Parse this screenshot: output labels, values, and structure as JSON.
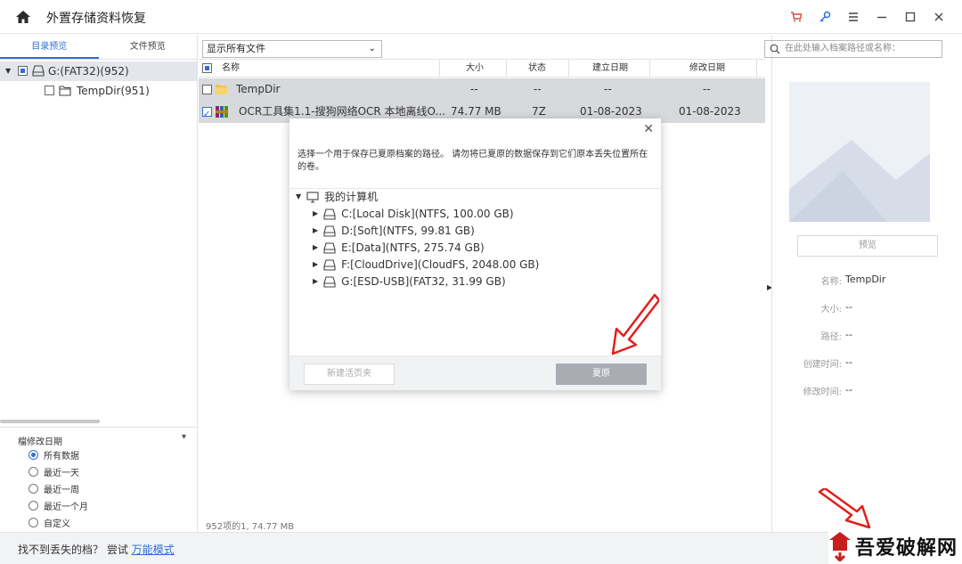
{
  "title_bar": {
    "app_title": "外置存储资料恢复",
    "icons": [
      "home-icon",
      "cart-icon",
      "key-icon",
      "menu-icon",
      "minimize-icon",
      "maximize-icon",
      "close-icon"
    ],
    "accent_cart": "#e0463d",
    "accent_key": "#2d6fd6"
  },
  "left_panel": {
    "tabs": [
      "目录预览",
      "文件预览"
    ],
    "active_tab": 0,
    "tree": [
      {
        "label": "G:(FAT32)(952)",
        "selected": true
      },
      {
        "label": "TempDir(951)",
        "selected": false
      }
    ],
    "filter": {
      "title": "檔修改日期",
      "options": [
        "所有数据",
        "最近一天",
        "最近一周",
        "最近一个月",
        "自定义"
      ],
      "selected": 0
    }
  },
  "middle": {
    "view_select": "显示所有文件",
    "columns": {
      "name": "名称",
      "size": "大小",
      "status": "状态",
      "created": "建立日期",
      "modified": "修改日期"
    },
    "rows": [
      {
        "name": "TempDir",
        "size": "--",
        "status": "--",
        "created": "--",
        "modified": "--",
        "checked": false
      },
      {
        "name": "OCR工具集1.1-搜狗网络OCR 本地离线O...",
        "size": "74.77  MB",
        "status": "7Z",
        "created": "01-08-2023",
        "modified": "01-08-2023",
        "checked": true
      }
    ],
    "status_text": "952项的1, 74.77  MB"
  },
  "right_panel": {
    "search_placeholder": "在此处输入档案路径或名称：",
    "preview_button": "预览",
    "info": {
      "name_label": "名称:",
      "name_value": "TempDir",
      "size_label": "大小:",
      "size_value": "--",
      "path_label": "路径:",
      "path_value": "--",
      "created_label": "创建时间:",
      "created_value": "--",
      "modified_label": "修改时间:",
      "modified_value": "--"
    }
  },
  "dialog": {
    "message": "选择一个用于保存已夏原档案的路径。 请勿将已夏原的数据保存到它们原本丢失位置所在的卷。",
    "root": "我的计算机",
    "drives": [
      "C:[Local Disk](NTFS, 100.00  GB)",
      "D:[Soft](NTFS, 99.81  GB)",
      "E:[Data](NTFS, 275.74  GB)",
      "F:[CloudDrive](CloudFS, 2048.00  GB)",
      "G:[ESD-USB](FAT32, 31.99  GB)"
    ],
    "new_folder_button": "新建活页夹",
    "recover_button": "夏原"
  },
  "bottom_bar": {
    "prompt": "找不到丢失的档？ 尝试 ",
    "link": "万能模式"
  },
  "watermark": {
    "text": "吾爱破解网"
  }
}
